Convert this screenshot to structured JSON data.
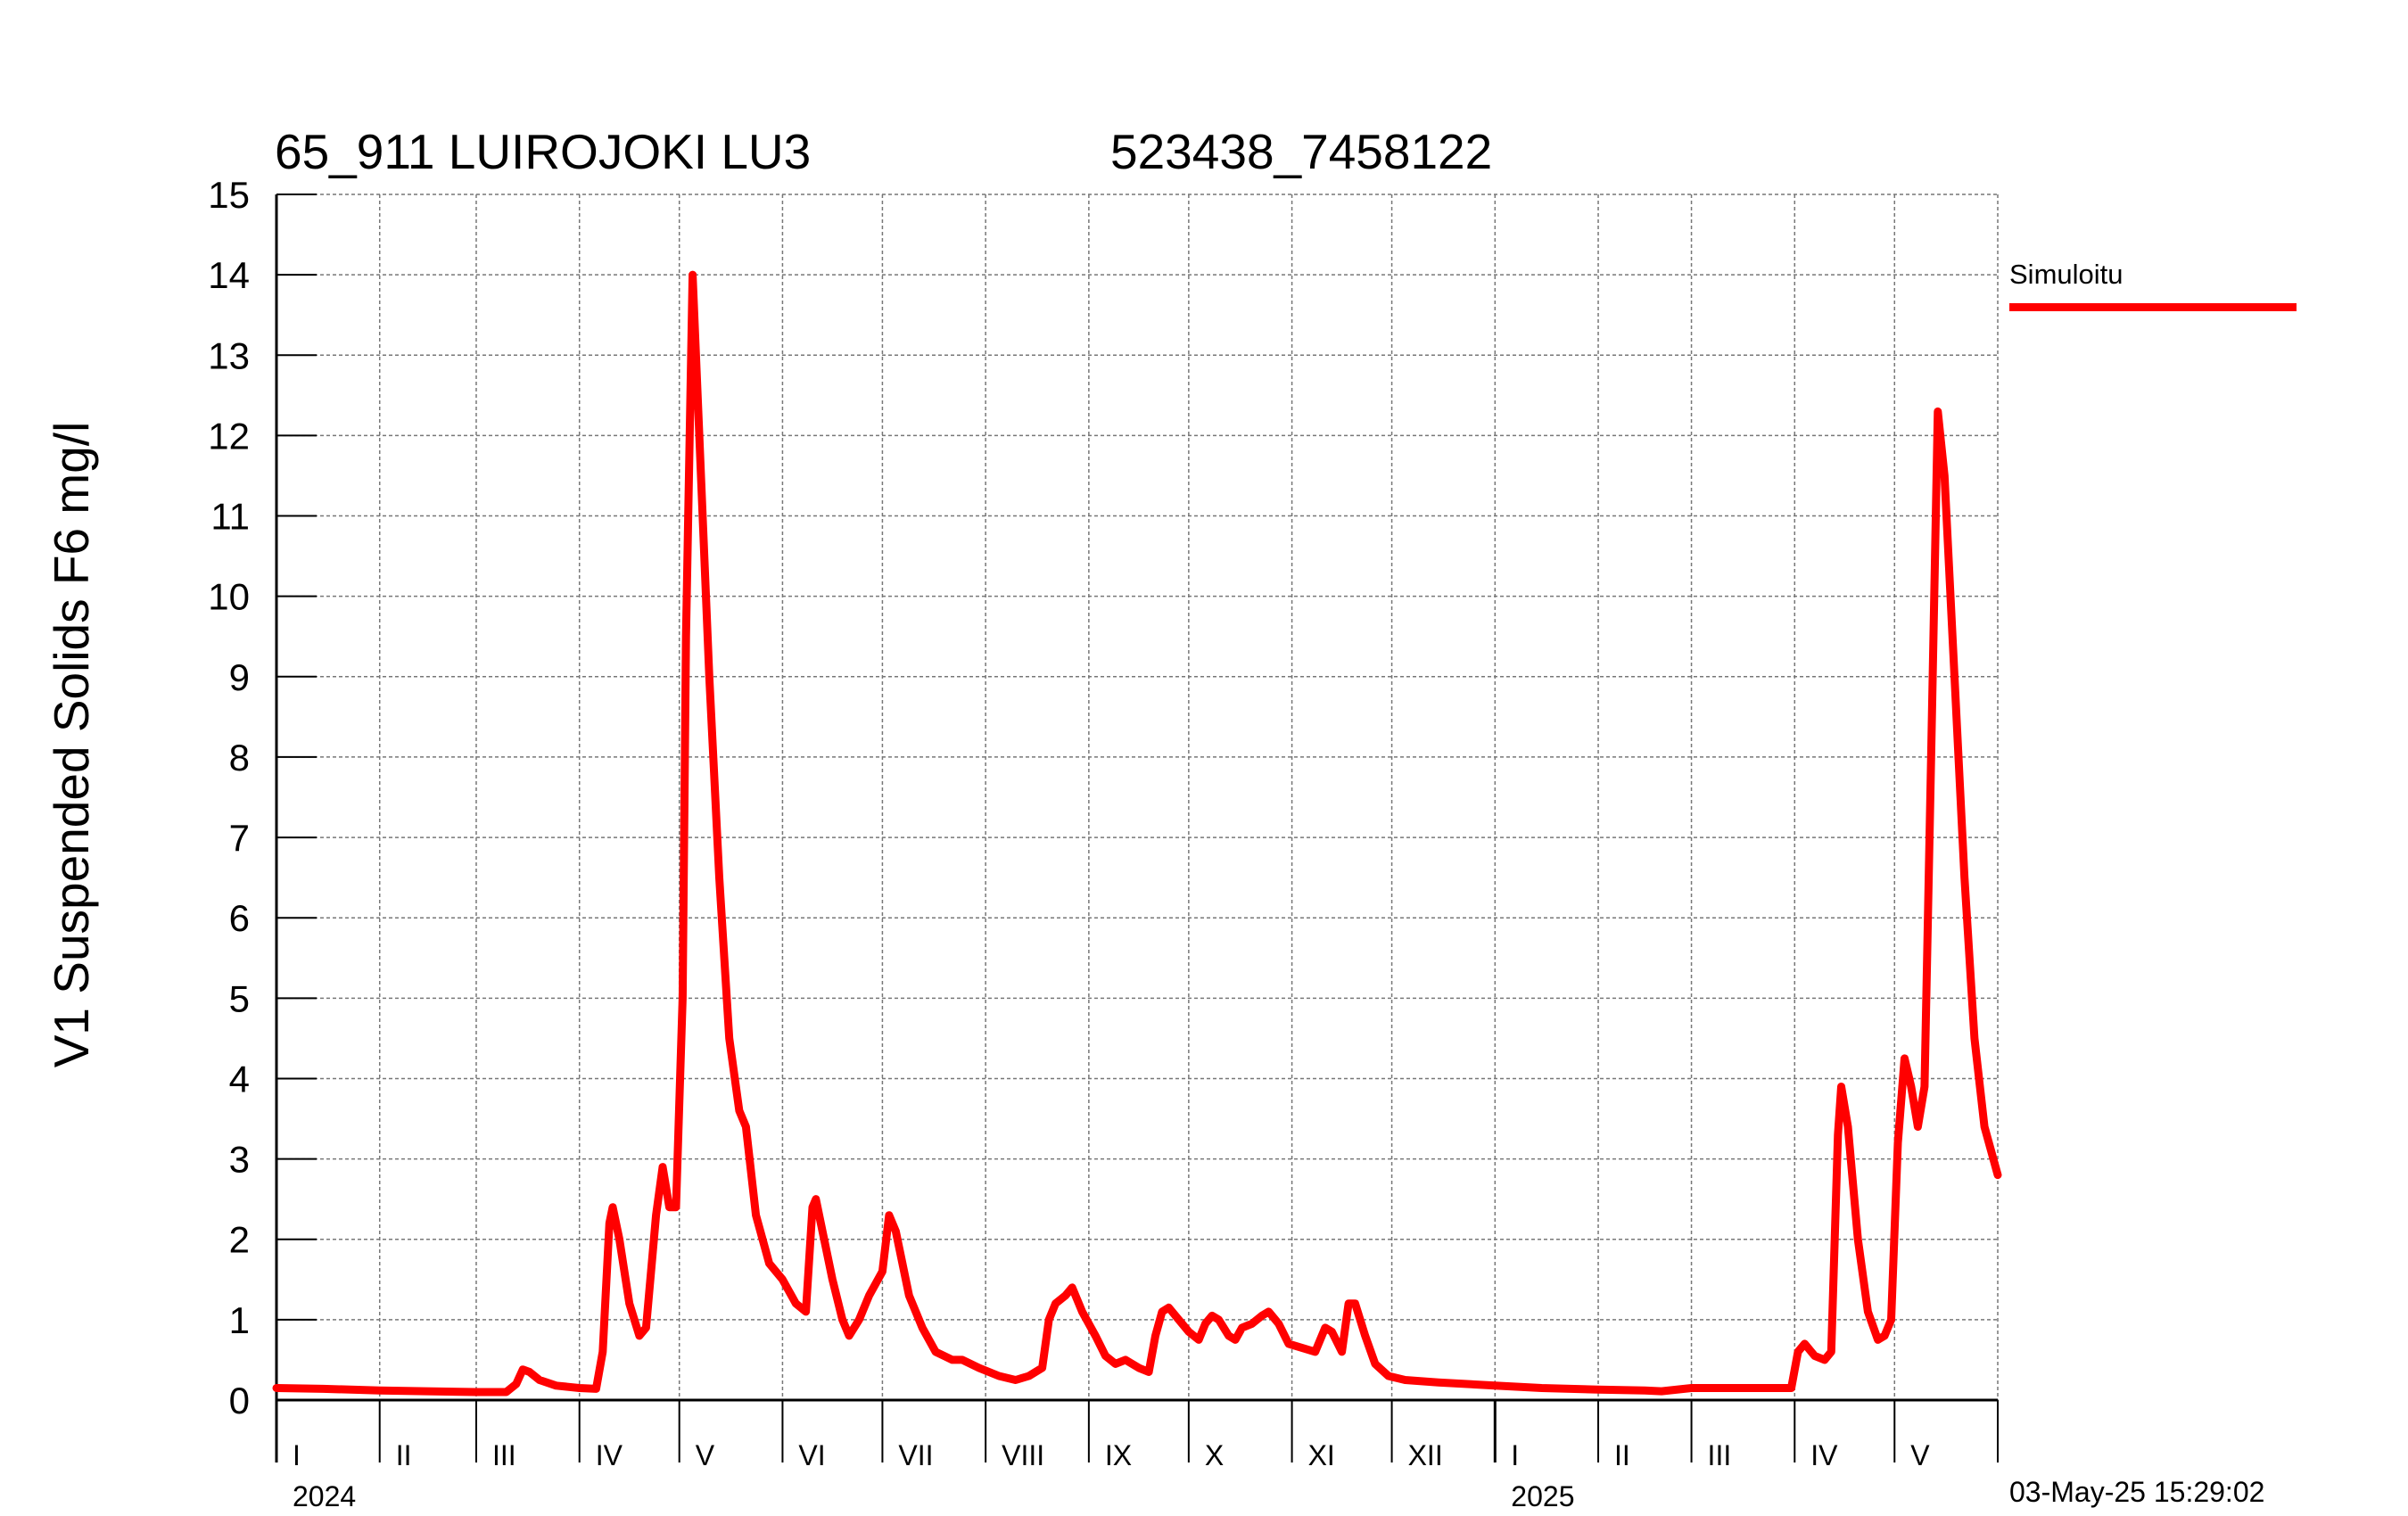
{
  "title": "65_911 LUIROJOKI LU3",
  "station_id": "523438_7458122",
  "ylabel": "V1 Suspended Solids F6 mg/l",
  "legend": {
    "label": "Simuloitu",
    "color": "#ff0000"
  },
  "timestamp": "03-May-25 15:29:02",
  "chart_data": {
    "type": "line",
    "title": "65_911 LUIROJOKI LU3",
    "subtitle": "523438_7458122",
    "ylabel": "V1 Suspended Solids F6 mg/l",
    "xlabel": "",
    "ylim": [
      0,
      15
    ],
    "yticks": [
      0,
      1,
      2,
      3,
      4,
      5,
      6,
      7,
      8,
      9,
      10,
      11,
      12,
      13,
      14,
      15
    ],
    "xlim": [
      "2024-01-01",
      "2025-06-01"
    ],
    "grid": true,
    "legend_position": "right",
    "month_ticks": [
      {
        "label": "I",
        "date": "2024-01-01"
      },
      {
        "label": "II",
        "date": "2024-02-01"
      },
      {
        "label": "III",
        "date": "2024-03-01"
      },
      {
        "label": "IV",
        "date": "2024-04-01"
      },
      {
        "label": "V",
        "date": "2024-05-01"
      },
      {
        "label": "VI",
        "date": "2024-06-01"
      },
      {
        "label": "VII",
        "date": "2024-07-01"
      },
      {
        "label": "VIII",
        "date": "2024-08-01"
      },
      {
        "label": "IX",
        "date": "2024-09-01"
      },
      {
        "label": "X",
        "date": "2024-10-01"
      },
      {
        "label": "XI",
        "date": "2024-11-01"
      },
      {
        "label": "XII",
        "date": "2024-12-01"
      },
      {
        "label": "I",
        "date": "2025-01-01"
      },
      {
        "label": "II",
        "date": "2025-02-01"
      },
      {
        "label": "III",
        "date": "2025-03-01"
      },
      {
        "label": "IV",
        "date": "2025-04-01"
      },
      {
        "label": "V",
        "date": "2025-05-01"
      }
    ],
    "year_labels": [
      {
        "label": "2024",
        "date": "2024-01-01"
      },
      {
        "label": "2025",
        "date": "2025-01-01"
      }
    ],
    "series": [
      {
        "name": "Simuloitu",
        "color": "#ff0000",
        "points": [
          [
            "2024-01-01",
            0.15
          ],
          [
            "2024-01-15",
            0.14
          ],
          [
            "2024-02-01",
            0.12
          ],
          [
            "2024-02-15",
            0.11
          ],
          [
            "2024-03-01",
            0.1
          ],
          [
            "2024-03-10",
            0.1
          ],
          [
            "2024-03-13",
            0.2
          ],
          [
            "2024-03-15",
            0.38
          ],
          [
            "2024-03-17",
            0.35
          ],
          [
            "2024-03-20",
            0.25
          ],
          [
            "2024-03-25",
            0.18
          ],
          [
            "2024-04-01",
            0.15
          ],
          [
            "2024-04-06",
            0.14
          ],
          [
            "2024-04-08",
            0.6
          ],
          [
            "2024-04-10",
            2.2
          ],
          [
            "2024-04-11",
            2.4
          ],
          [
            "2024-04-13",
            2.0
          ],
          [
            "2024-04-16",
            1.2
          ],
          [
            "2024-04-19",
            0.8
          ],
          [
            "2024-04-21",
            0.9
          ],
          [
            "2024-04-24",
            2.3
          ],
          [
            "2024-04-26",
            2.9
          ],
          [
            "2024-04-28",
            2.4
          ],
          [
            "2024-04-30",
            2.4
          ],
          [
            "2024-05-02",
            5.0
          ],
          [
            "2024-05-03",
            9.5
          ],
          [
            "2024-05-05",
            14.0
          ],
          [
            "2024-05-07",
            12.0
          ],
          [
            "2024-05-10",
            9.0
          ],
          [
            "2024-05-13",
            6.5
          ],
          [
            "2024-05-16",
            4.5
          ],
          [
            "2024-05-19",
            3.6
          ],
          [
            "2024-05-21",
            3.4
          ],
          [
            "2024-05-24",
            2.3
          ],
          [
            "2024-05-28",
            1.7
          ],
          [
            "2024-06-01",
            1.5
          ],
          [
            "2024-06-05",
            1.2
          ],
          [
            "2024-06-08",
            1.1
          ],
          [
            "2024-06-10",
            2.4
          ],
          [
            "2024-06-11",
            2.5
          ],
          [
            "2024-06-13",
            2.1
          ],
          [
            "2024-06-16",
            1.5
          ],
          [
            "2024-06-19",
            1.0
          ],
          [
            "2024-06-21",
            0.8
          ],
          [
            "2024-06-24",
            1.0
          ],
          [
            "2024-06-27",
            1.3
          ],
          [
            "2024-07-01",
            1.6
          ],
          [
            "2024-07-03",
            2.3
          ],
          [
            "2024-07-05",
            2.1
          ],
          [
            "2024-07-09",
            1.3
          ],
          [
            "2024-07-13",
            0.9
          ],
          [
            "2024-07-17",
            0.6
          ],
          [
            "2024-07-22",
            0.5
          ],
          [
            "2024-07-25",
            0.5
          ],
          [
            "2024-07-30",
            0.4
          ],
          [
            "2024-08-05",
            0.3
          ],
          [
            "2024-08-10",
            0.25
          ],
          [
            "2024-08-14",
            0.3
          ],
          [
            "2024-08-18",
            0.4
          ],
          [
            "2024-08-20",
            1.0
          ],
          [
            "2024-08-22",
            1.2
          ],
          [
            "2024-08-25",
            1.3
          ],
          [
            "2024-08-27",
            1.4
          ],
          [
            "2024-08-30",
            1.1
          ],
          [
            "2024-09-03",
            0.8
          ],
          [
            "2024-09-06",
            0.55
          ],
          [
            "2024-09-09",
            0.45
          ],
          [
            "2024-09-12",
            0.5
          ],
          [
            "2024-09-16",
            0.4
          ],
          [
            "2024-09-19",
            0.35
          ],
          [
            "2024-09-21",
            0.8
          ],
          [
            "2024-09-23",
            1.1
          ],
          [
            "2024-09-25",
            1.15
          ],
          [
            "2024-09-28",
            1.0
          ],
          [
            "2024-10-01",
            0.85
          ],
          [
            "2024-10-04",
            0.75
          ],
          [
            "2024-10-06",
            0.95
          ],
          [
            "2024-10-08",
            1.05
          ],
          [
            "2024-10-10",
            1.0
          ],
          [
            "2024-10-13",
            0.8
          ],
          [
            "2024-10-15",
            0.75
          ],
          [
            "2024-10-17",
            0.9
          ],
          [
            "2024-10-20",
            0.95
          ],
          [
            "2024-10-23",
            1.05
          ],
          [
            "2024-10-25",
            1.1
          ],
          [
            "2024-10-28",
            0.95
          ],
          [
            "2024-10-31",
            0.7
          ],
          [
            "2024-11-04",
            0.65
          ],
          [
            "2024-11-08",
            0.6
          ],
          [
            "2024-11-11",
            0.9
          ],
          [
            "2024-11-13",
            0.85
          ],
          [
            "2024-11-16",
            0.6
          ],
          [
            "2024-11-18",
            1.2
          ],
          [
            "2024-11-20",
            1.2
          ],
          [
            "2024-11-23",
            0.8
          ],
          [
            "2024-11-26",
            0.45
          ],
          [
            "2024-11-30",
            0.3
          ],
          [
            "2024-12-05",
            0.25
          ],
          [
            "2024-12-15",
            0.22
          ],
          [
            "2025-01-01",
            0.18
          ],
          [
            "2025-01-15",
            0.15
          ],
          [
            "2025-02-01",
            0.13
          ],
          [
            "2025-02-15",
            0.12
          ],
          [
            "2025-02-20",
            0.11
          ],
          [
            "2025-03-01",
            0.15
          ],
          [
            "2025-03-15",
            0.15
          ],
          [
            "2025-03-25",
            0.15
          ],
          [
            "2025-03-31",
            0.15
          ],
          [
            "2025-04-02",
            0.6
          ],
          [
            "2025-04-04",
            0.7
          ],
          [
            "2025-04-07",
            0.55
          ],
          [
            "2025-04-10",
            0.5
          ],
          [
            "2025-04-12",
            0.6
          ],
          [
            "2025-04-14",
            3.3
          ],
          [
            "2025-04-15",
            3.9
          ],
          [
            "2025-04-17",
            3.4
          ],
          [
            "2025-04-20",
            2.0
          ],
          [
            "2025-04-23",
            1.1
          ],
          [
            "2025-04-26",
            0.75
          ],
          [
            "2025-04-28",
            0.8
          ],
          [
            "2025-04-30",
            1.0
          ],
          [
            "2025-05-02",
            3.2
          ],
          [
            "2025-05-04",
            4.25
          ],
          [
            "2025-05-06",
            3.9
          ],
          [
            "2025-05-08",
            3.4
          ],
          [
            "2025-05-10",
            3.9
          ],
          [
            "2025-05-12",
            8.0
          ],
          [
            "2025-05-14",
            12.3
          ],
          [
            "2025-05-16",
            11.5
          ],
          [
            "2025-05-19",
            9.0
          ],
          [
            "2025-05-22",
            6.5
          ],
          [
            "2025-05-25",
            4.5
          ],
          [
            "2025-05-28",
            3.4
          ],
          [
            "2025-06-01",
            2.8
          ]
        ]
      }
    ]
  }
}
